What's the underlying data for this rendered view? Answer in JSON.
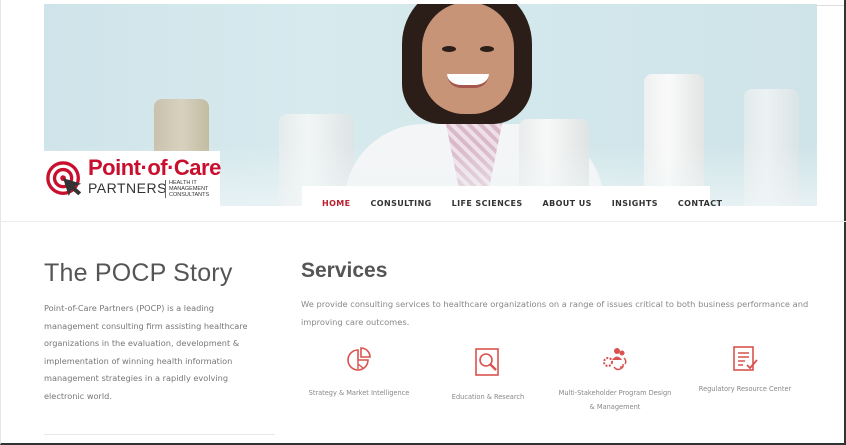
{
  "logo": {
    "title": "Point·of·Care",
    "subtitle": "PARTNERS",
    "tagline": [
      "HEALTH IT",
      "MANAGEMENT",
      "CONSULTANTS"
    ],
    "brand_color": "#c8102e"
  },
  "nav": {
    "items": [
      {
        "label": "HOME",
        "active": true
      },
      {
        "label": "CONSULTING"
      },
      {
        "label": "LIFE SCIENCES"
      },
      {
        "label": "ABOUT US"
      },
      {
        "label": "INSIGHTS"
      },
      {
        "label": "CONTACT"
      }
    ],
    "active_color": "#b8202f"
  },
  "story": {
    "title": "The POCP Story",
    "text": "Point-of-Care Partners (POCP) is a leading management consulting firm assisting healthcare organizations in the evaluation, development & implementation of winning health information management strategies in a rapidly evolving electronic world."
  },
  "services": {
    "title": "Services",
    "intro": "We provide consulting services to healthcare organizations on a range of issues critical to both business performance and improving care outcomes.",
    "accent": "#d9534f",
    "items": [
      {
        "label": "Strategy & Market Intelligence",
        "icon": "pie-chart-icon"
      },
      {
        "label": "Education & Research",
        "icon": "magnifier-document-icon"
      },
      {
        "label": "Multi-Stakeholder Program Design & Management",
        "icon": "people-gear-icon"
      },
      {
        "label": "Regulatory Resource Center",
        "icon": "checklist-document-icon"
      }
    ]
  }
}
